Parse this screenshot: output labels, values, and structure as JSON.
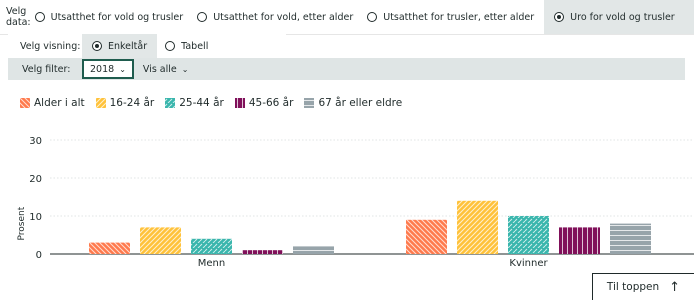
{
  "data_select": {
    "label": "Velg data:",
    "options": [
      "Utsatthet for vold og trusler",
      "Utsatthet for vold, etter alder",
      "Utsatthet for trusler, etter alder",
      "Uro for vold og trusler"
    ],
    "selected": 3
  },
  "view_select": {
    "label": "Velg visning:",
    "options": [
      "Enkeltår",
      "Tabell"
    ],
    "selected": 0
  },
  "filter": {
    "label": "Velg filter:",
    "year": "2018",
    "show": "Vis alle"
  },
  "back_to_top": "Til toppen",
  "colors": {
    "selected_bg": "#e2e7e7",
    "filter_bar_bg": "#dfe5e5",
    "active_border": "#1f5c4e"
  },
  "chart_data": {
    "type": "bar",
    "categories": [
      "Menn",
      "Kvinner"
    ],
    "series": [
      {
        "name": "Alder i alt",
        "color": "#ff7a4d",
        "pattern": "diag-down",
        "values": [
          3,
          9
        ]
      },
      {
        "name": "16-24 år",
        "color": "#ffc23a",
        "pattern": "diag-up",
        "values": [
          7,
          14
        ]
      },
      {
        "name": "25-44 år",
        "color": "#3ab6ad",
        "pattern": "dots",
        "values": [
          4,
          10
        ]
      },
      {
        "name": "45-66 år",
        "color": "#80105a",
        "pattern": "vertical",
        "values": [
          1,
          7
        ]
      },
      {
        "name": "67 år eller eldre",
        "color": "#97a4aa",
        "pattern": "horizontal",
        "values": [
          2,
          8
        ]
      }
    ],
    "ylabel": "Prosent",
    "ylim": [
      0,
      30
    ],
    "yticks": [
      0,
      10,
      20,
      30
    ],
    "grid": true,
    "legend": "top-left"
  }
}
